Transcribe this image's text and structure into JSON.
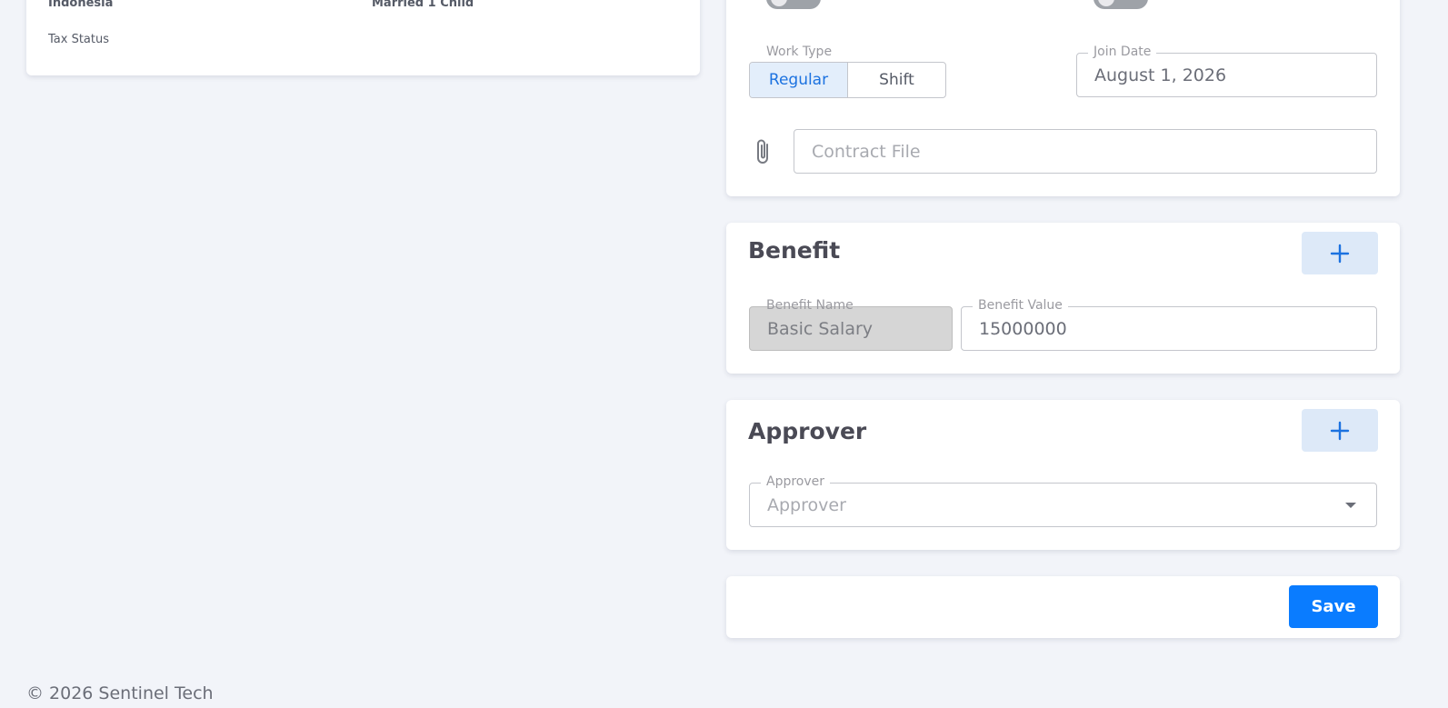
{
  "profile": {
    "nationality": "Indonesia",
    "marital_status": "Married 1 Child",
    "tax_status_label": "Tax Status"
  },
  "employment": {
    "work_type": {
      "label": "Work Type",
      "options": [
        "Regular",
        "Shift"
      ],
      "selected": "Regular"
    },
    "join_date": {
      "label": "Join Date",
      "value": "August 1, 2026"
    },
    "contract_file": {
      "placeholder": "Contract File",
      "icon": "paperclip-icon"
    }
  },
  "benefit": {
    "title": "Benefit",
    "add_icon": "plus-icon",
    "name_label": "Benefit Name",
    "name_value": "Basic Salary",
    "value_label": "Benefit Value",
    "value_value": "15000000"
  },
  "approver": {
    "title": "Approver",
    "add_icon": "plus-icon",
    "field_label": "Approver",
    "field_placeholder": "Approver"
  },
  "actions": {
    "save_label": "Save"
  },
  "footer": {
    "copyright": "© 2026 Sentinel Tech"
  },
  "colors": {
    "primary": "#0a7cff",
    "primary_light": "#dde9f8",
    "background": "#f2f4f9"
  }
}
